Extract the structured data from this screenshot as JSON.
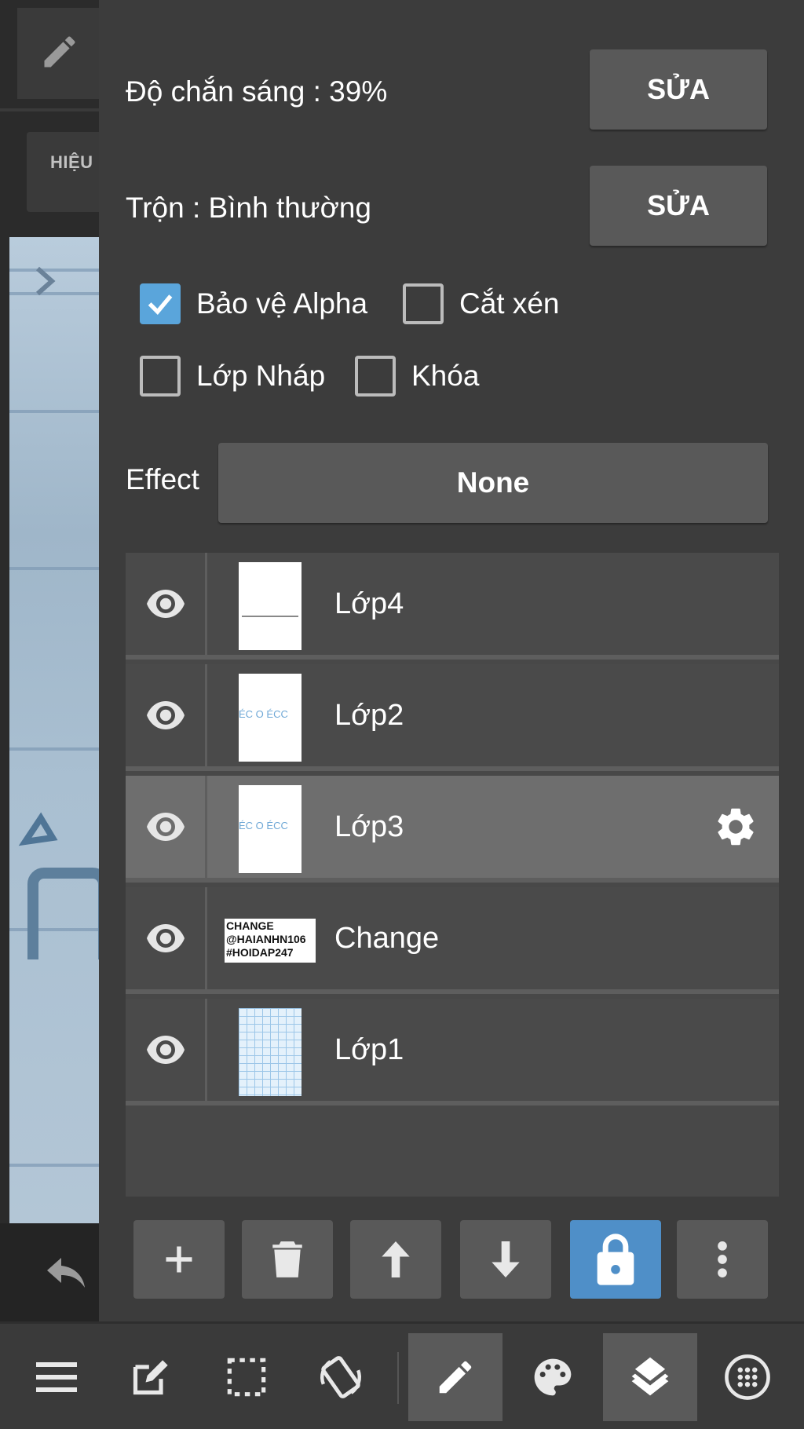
{
  "canvas_strip": {
    "effect_tab_label": "HIỆU"
  },
  "layer_properties": {
    "opacity_label": "Độ chắn sáng : 39%",
    "opacity_value": 39,
    "opacity_edit_label": "SỬA",
    "blend_label": "Trộn : Bình thường",
    "blend_edit_label": "SỬA",
    "checkboxes": [
      {
        "label": "Bảo vệ Alpha",
        "checked": true
      },
      {
        "label": "Cắt xén",
        "checked": false
      },
      {
        "label": "Lớp Nháp",
        "checked": false
      },
      {
        "label": "Khóa",
        "checked": false
      }
    ],
    "effect_label": "Effect",
    "effect_value": "None"
  },
  "layers": [
    {
      "name": "Lớp4",
      "visible": true,
      "selected": false
    },
    {
      "name": "Lớp2",
      "visible": true,
      "selected": false,
      "thumb_text": "ÉC O ÉCC"
    },
    {
      "name": "Lớp3",
      "visible": true,
      "selected": true,
      "thumb_text": "ÉC O ÉCC"
    },
    {
      "name": "Change",
      "visible": true,
      "selected": false,
      "thumb_lines": [
        "CHANGE",
        "@HAIANHN106",
        "#HOIDAP247"
      ]
    },
    {
      "name": "Lớp1",
      "visible": true,
      "selected": false
    }
  ],
  "layer_actions": [
    {
      "icon": "plus-icon"
    },
    {
      "icon": "trash-icon"
    },
    {
      "icon": "arrow-up-icon"
    },
    {
      "icon": "arrow-down-icon"
    },
    {
      "icon": "lock-icon",
      "active": true
    },
    {
      "icon": "more-vertical-icon"
    }
  ],
  "toolbar": [
    {
      "icon": "menu-icon"
    },
    {
      "icon": "edit-square-icon"
    },
    {
      "icon": "selection-icon"
    },
    {
      "icon": "rotate-canvas-icon"
    },
    {
      "icon": "pen-icon",
      "active": true
    },
    {
      "icon": "palette-icon"
    },
    {
      "icon": "layers-icon",
      "active": true
    },
    {
      "icon": "materials-icon"
    }
  ],
  "colors": {
    "panel_bg": "#3c3c3c",
    "button_bg": "#595959",
    "selected_row": "#6e6e6e",
    "accent_blue": "#4f8fc8",
    "checkbox_checked": "#5aa5db"
  }
}
